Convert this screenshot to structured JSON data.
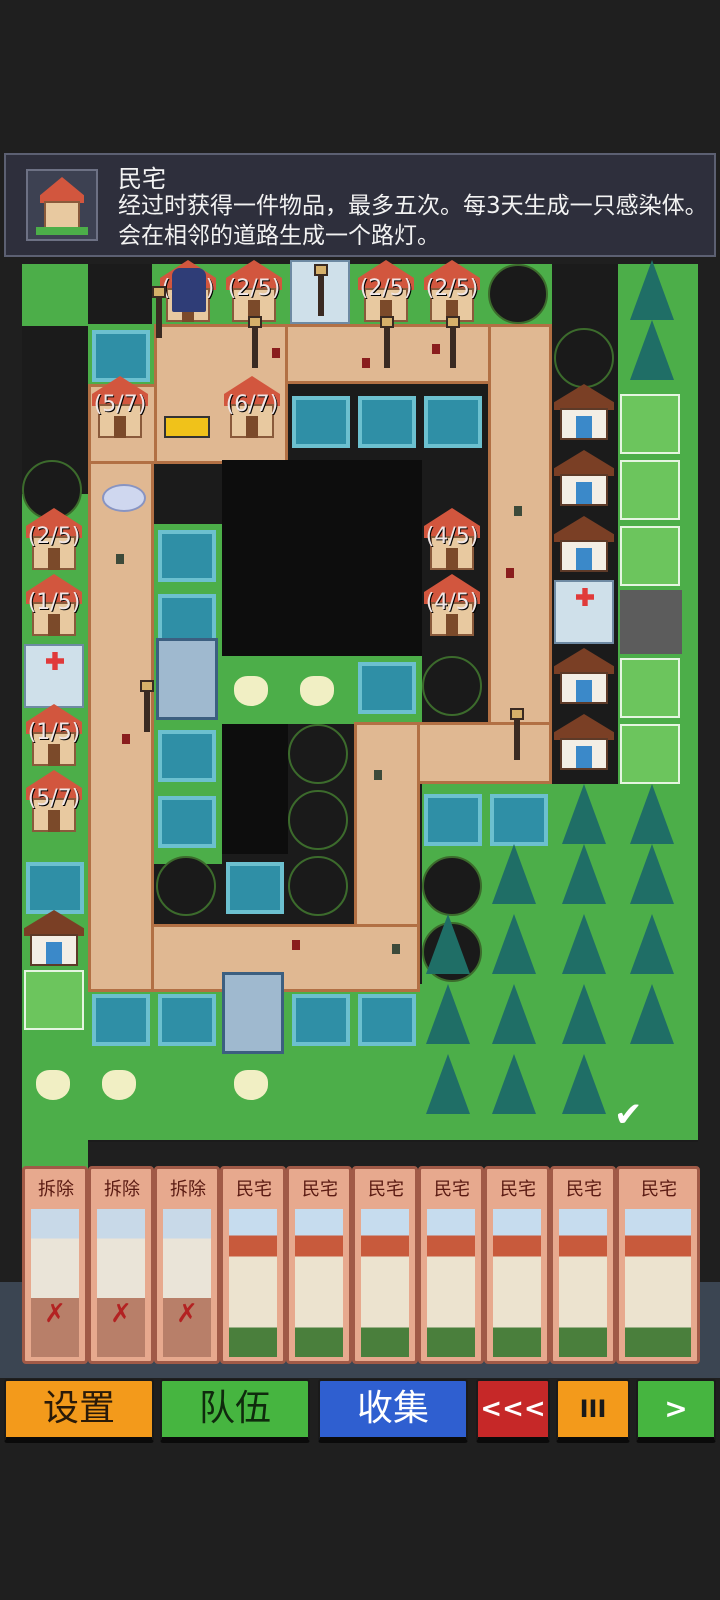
{
  "tooltip": {
    "title": "民宅",
    "description": "经过时获得一件物品，最多五次。每3天生成一只感染体。会在相邻的道路生成一个路灯。",
    "icon": "house-icon"
  },
  "map": {
    "house_labels": {
      "top1": "(2/5)",
      "top2": "(2/5)",
      "top3": "(2/5)",
      "top4": "(2/5)",
      "left_upper": "(5/7)",
      "mid_upper": "(6/7)",
      "left_a": "(2/5)",
      "left_b": "(1/5)",
      "left_c": "(1/5)",
      "left_d": "(5/7)",
      "right_a": "(4/5)",
      "right_b": "(4/5)"
    }
  },
  "hand": {
    "cards": [
      {
        "label": "拆除",
        "type": "demolish"
      },
      {
        "label": "拆除",
        "type": "demolish"
      },
      {
        "label": "拆除",
        "type": "demolish"
      },
      {
        "label": "民宅",
        "type": "residence"
      },
      {
        "label": "民宅",
        "type": "residence"
      },
      {
        "label": "民宅",
        "type": "residence"
      },
      {
        "label": "民宅",
        "type": "residence"
      },
      {
        "label": "民宅",
        "type": "residence"
      },
      {
        "label": "民宅",
        "type": "residence"
      },
      {
        "label": "民宅",
        "type": "residence"
      }
    ]
  },
  "buttons": {
    "settings": "设置",
    "team": "队伍",
    "collection": "收集",
    "rewind": "<<<",
    "pause": "III",
    "play": ">"
  },
  "colors": {
    "settings": "#f39a1b",
    "team": "#46b540",
    "collection": "#2f5fd0",
    "rewind": "#c62828",
    "pause": "#f39a1b",
    "play": "#46b540"
  }
}
